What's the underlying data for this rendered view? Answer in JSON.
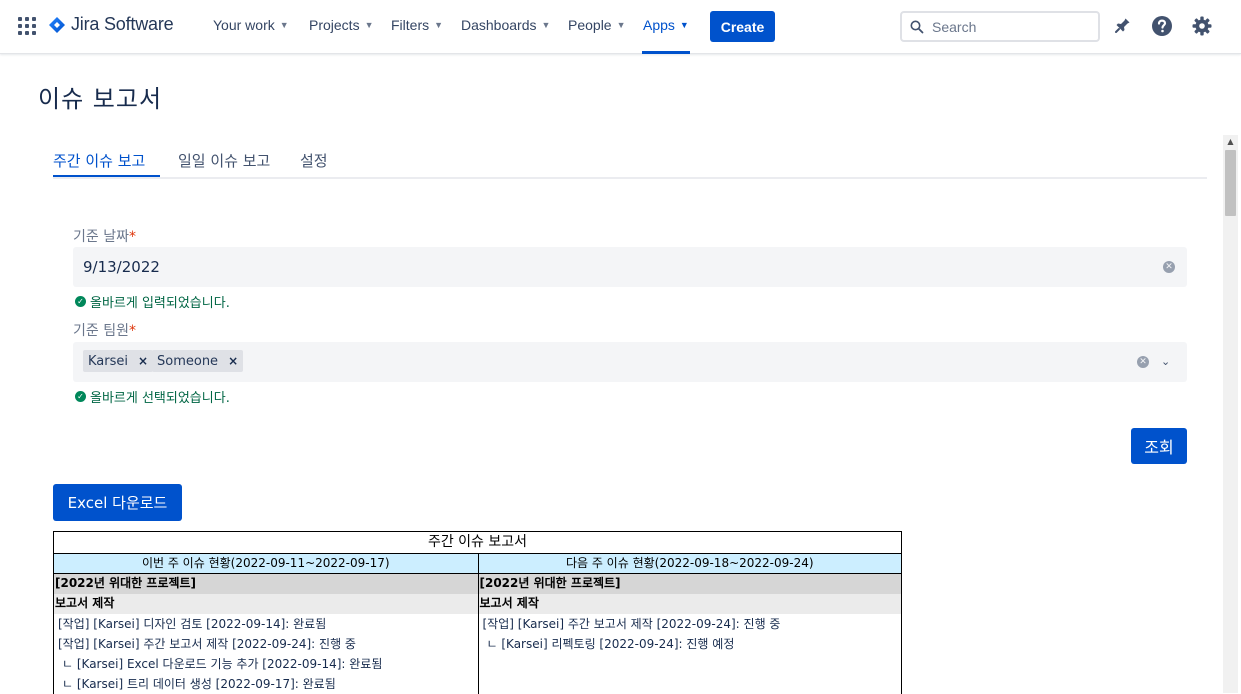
{
  "nav": {
    "logo_text": "Jira Software",
    "items": [
      {
        "label": "Your work"
      },
      {
        "label": "Projects"
      },
      {
        "label": "Filters"
      },
      {
        "label": "Dashboards"
      },
      {
        "label": "People"
      },
      {
        "label": "Apps"
      }
    ],
    "active_item": "Apps",
    "create_label": "Create",
    "search_placeholder": "Search",
    "accent_color": "#0052CC"
  },
  "page": {
    "title": "이슈 보고서",
    "tabs": [
      {
        "label": "주간 이슈 보고"
      },
      {
        "label": "일일 이슈 보고"
      },
      {
        "label": "설정"
      }
    ],
    "active_tab": "주간 이슈 보고"
  },
  "form": {
    "date_label": "기준 날짜",
    "required_mark": "*",
    "date_value": "9/13/2022",
    "date_valid_msg": "올바르게 입력되었습니다.",
    "team_label": "기준 팀원",
    "team_members": [
      {
        "name": "Karsei"
      },
      {
        "name": "Someone"
      }
    ],
    "team_valid_msg": "올바르게 선택되었습니다.",
    "query_button": "조회"
  },
  "excel_button": "Excel 다운로드",
  "report": {
    "title": "주간 이슈 보고서",
    "this_week": {
      "header": "이번 주 이슈 현황(2022-09-11~2022-09-17)",
      "project": "[2022년 위대한 프로젝트]",
      "section": "보고서 제작",
      "items": [
        " [작업] [Karsei] 디자인 검토 [2022-09-14]: 완료됨",
        " [작업] [Karsei] 주간 보고서 제작 [2022-09-24]: 진행 중",
        "   ㄴ [Karsei] Excel 다운로드 기능 추가 [2022-09-14]: 완료됨",
        "   ㄴ [Karsei] 트리 데이터 생성 [2022-09-17]: 완료됨"
      ]
    },
    "next_week": {
      "header": "다음 주 이슈 현황(2022-09-18~2022-09-24)",
      "project": "[2022년 위대한 프로젝트]",
      "section": "보고서 제작",
      "items": [
        " [작업] [Karsei] 주간 보고서 제작 [2022-09-24]: 진행 중",
        "   ㄴ [Karsei] 리펙토링 [2022-09-24]: 진행 예정"
      ]
    }
  }
}
